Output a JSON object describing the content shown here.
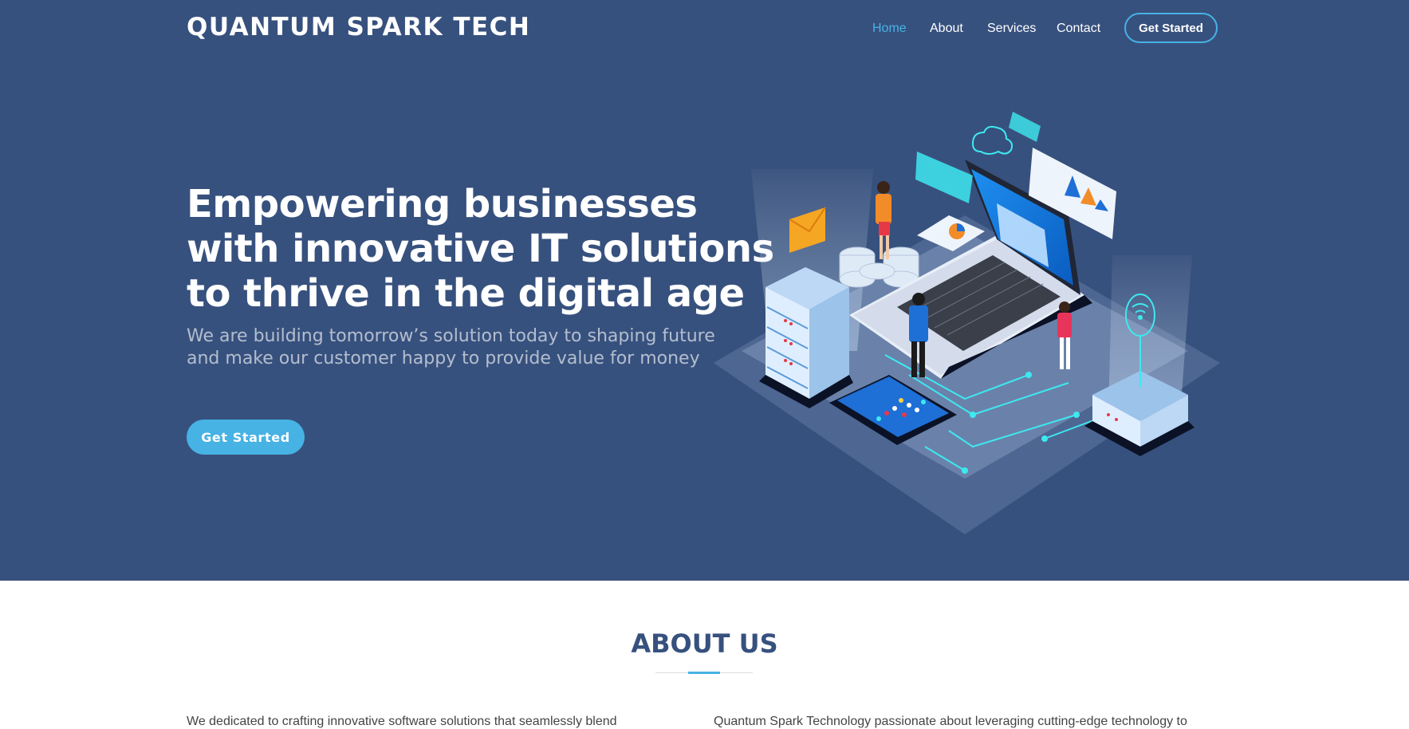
{
  "header": {
    "logo": "QUANTUM SPARK TECH",
    "nav": [
      "Home",
      "About",
      "Services",
      "Contact"
    ],
    "active_nav": "Home",
    "cta_label": "Get Started"
  },
  "hero": {
    "headline_lines": [
      "Empowering businesses",
      "with innovative IT solutions",
      "to thrive in the digital age"
    ],
    "subhead_lines": [
      "We are building tomorrow’s solution today to shaping future",
      "and make our customer happy to provide value for money"
    ],
    "cta_label": "Get Started"
  },
  "about": {
    "title": "ABOUT US",
    "col_left": "We dedicated to crafting innovative software solutions that seamlessly blend",
    "col_right": "Quantum Spark Technology passionate about leveraging cutting-edge technology to"
  },
  "colors": {
    "hero_bg": "#37517e",
    "accent": "#47b2e4",
    "text_light": "#ffffff"
  },
  "icons": [
    "email-envelope-icon",
    "cloud-icon",
    "wifi-icon",
    "chart-icon"
  ]
}
